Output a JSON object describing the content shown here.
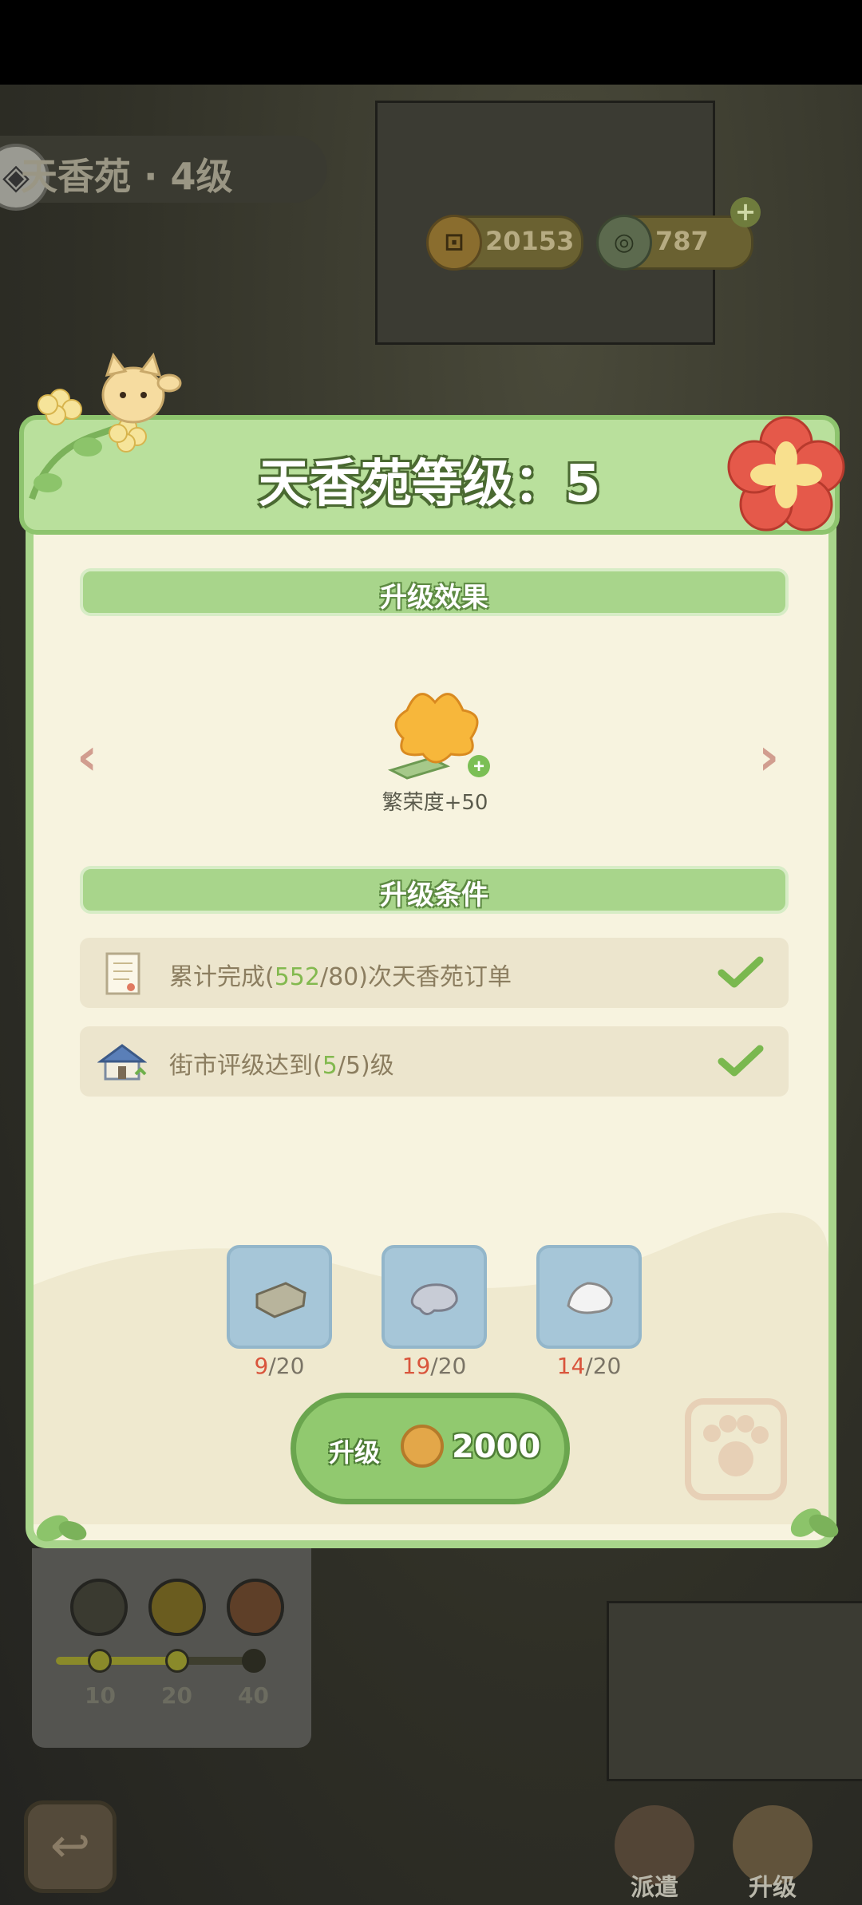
{
  "header": {
    "location_title": "天香苑 · 4级",
    "currency": [
      {
        "icon": "copper-coin-icon",
        "value": "20153"
      },
      {
        "icon": "jade-coin-icon",
        "value": "787",
        "plus": "+"
      }
    ]
  },
  "modal": {
    "title": "天香苑等级：5",
    "effect_section_label": "升级效果",
    "effect_icon": "flower-bouquet-icon",
    "effect_text": "繁荣度+50",
    "prev_arrow": "‹",
    "next_arrow": "›",
    "condition_section_label": "升级条件",
    "conditions": [
      {
        "prefix": "累计完成(",
        "current": "552",
        "sep": "/",
        "target": "80",
        "suffix": ")次天香苑订单",
        "met": true,
        "icon": "order-scroll-icon"
      },
      {
        "prefix": "街市评级达到(",
        "current": "5",
        "sep": "/",
        "target": "5",
        "suffix": ")级",
        "met": true,
        "icon": "market-house-icon"
      }
    ],
    "materials": [
      {
        "icon": "wood-plank-icon",
        "have": "9",
        "need": "/20"
      },
      {
        "icon": "stone-icon",
        "have": "19",
        "need": "/20"
      },
      {
        "icon": "white-stone-icon",
        "have": "14",
        "need": "/20"
      }
    ],
    "upgrade_button": {
      "label": "升级",
      "cost": "2000"
    }
  },
  "background": {
    "milestones": [
      "10",
      "20",
      "40"
    ],
    "bottom_nav": [
      "派遣",
      "升级"
    ]
  },
  "colors": {
    "modal_green": "#a8d58b",
    "modal_bg": "#f7f3df",
    "highlight_green": "#83b94f",
    "shortfall_red": "#d9553c"
  }
}
